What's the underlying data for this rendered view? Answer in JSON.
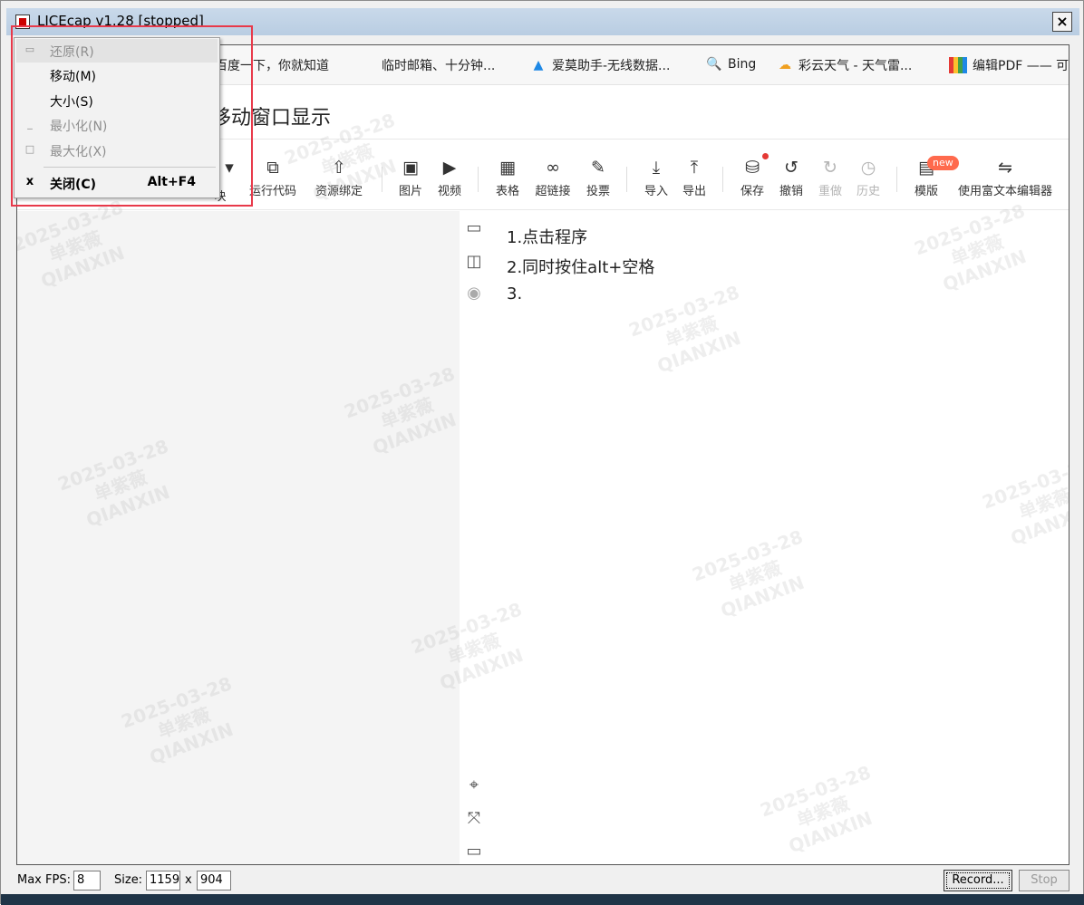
{
  "window": {
    "title": "LICEcap v1.28 [stopped]",
    "close_label": "×"
  },
  "bookmarks": [
    {
      "icon": "",
      "label": "百度一下，你就知道"
    },
    {
      "icon": "",
      "label": "临时邮箱、十分钟..."
    },
    {
      "icon": "▲",
      "label": "爱莫助手-无线数据..."
    },
    {
      "icon": "🔍",
      "label": "Bing"
    },
    {
      "icon": "☁",
      "label": "彩云天气 - 天气雷..."
    },
    {
      "icon": "■",
      "label": "编辑PDF —— 可"
    }
  ],
  "document": {
    "title": "移动窗口显示"
  },
  "toolbar": {
    "items": [
      {
        "icon": "▾",
        "label": "",
        "disabled": false
      },
      {
        "icon": "",
        "label": "块",
        "disabled": false
      },
      {
        "icon": "⧉",
        "label": "运行代码",
        "disabled": false
      },
      {
        "icon": "⇧",
        "label": "资源绑定",
        "disabled": false
      },
      {
        "icon": "▣",
        "label": "图片",
        "disabled": false
      },
      {
        "icon": "▶",
        "label": "视频",
        "disabled": false
      },
      {
        "icon": "▦",
        "label": "表格",
        "disabled": false
      },
      {
        "icon": "∞",
        "label": "超链接",
        "disabled": false
      },
      {
        "icon": "✎",
        "label": "投票",
        "disabled": false
      },
      {
        "icon": "⤓",
        "label": "导入",
        "disabled": false
      },
      {
        "icon": "⤒",
        "label": "导出",
        "disabled": false
      },
      {
        "icon": "⛁",
        "label": "保存",
        "disabled": false
      },
      {
        "icon": "↺",
        "label": "撤销",
        "disabled": false
      },
      {
        "icon": "↻",
        "label": "重做",
        "disabled": true
      },
      {
        "icon": "◷",
        "label": "历史",
        "disabled": true
      },
      {
        "icon": "▤",
        "label": "模版",
        "disabled": false
      },
      {
        "icon": "⇋",
        "label": "使用富文本编辑器",
        "disabled": false
      }
    ],
    "new_badge": "new"
  },
  "content": {
    "lines": [
      "1.点击程序",
      "2.同时按住alt+空格",
      "3."
    ]
  },
  "system_menu": {
    "items": [
      {
        "icon": "▭",
        "label": "还原(R)",
        "accel": "",
        "disabled": true
      },
      {
        "icon": "",
        "label": "移动(M)",
        "accel": "",
        "disabled": false
      },
      {
        "icon": "",
        "label": "大小(S)",
        "accel": "",
        "disabled": false
      },
      {
        "icon": "_",
        "label": "最小化(N)",
        "accel": "",
        "disabled": true
      },
      {
        "icon": "□",
        "label": "最大化(X)",
        "accel": "",
        "disabled": true
      },
      {
        "icon": "x",
        "label": "关闭(C)",
        "accel": "Alt+F4",
        "disabled": false
      }
    ]
  },
  "statusbar": {
    "max_fps_label": "Max FPS:",
    "max_fps_value": "8",
    "size_label": "Size:",
    "width_value": "1159",
    "x_label": "x",
    "height_value": "904",
    "record_label": "Record...",
    "stop_label": "Stop"
  },
  "watermark": {
    "date": "2025-03-28",
    "name": "单紫薇",
    "org": "QIANXIN"
  }
}
